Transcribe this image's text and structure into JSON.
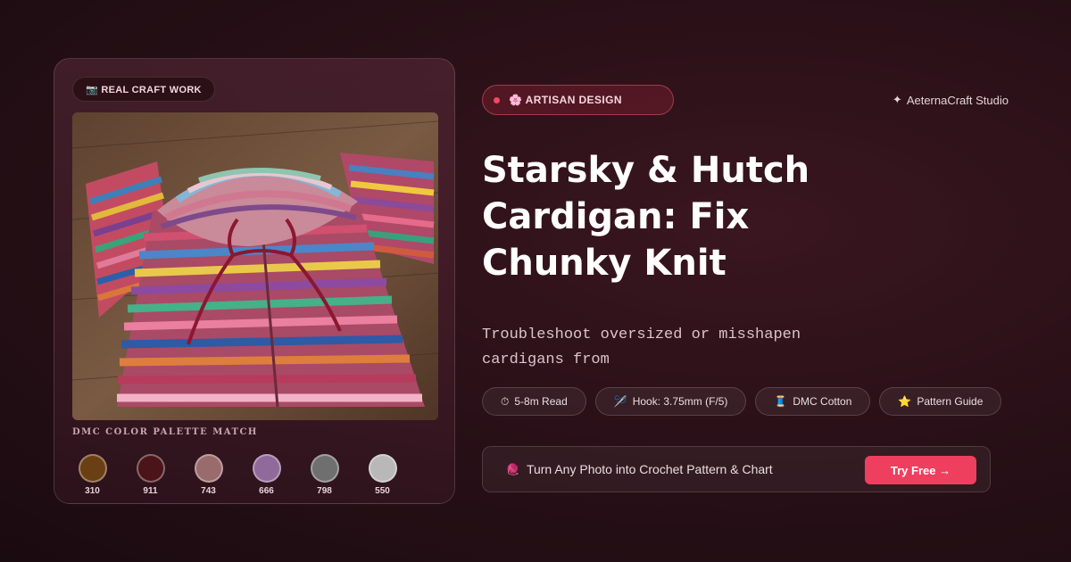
{
  "card": {
    "badge": {
      "icon": "camera-icon",
      "label": "📷 REAL CRAFT WORK"
    },
    "photo": {
      "subject": "cardigan-photo"
    },
    "palette": {
      "title": "DMC COLOR PALETTE MATCH",
      "swatches": [
        {
          "code": "310",
          "color": "#6b3f14"
        },
        {
          "code": "911",
          "color": "#4a1418"
        },
        {
          "code": "743",
          "color": "#9a6b6c"
        },
        {
          "code": "666",
          "color": "#8f6a9a"
        },
        {
          "code": "798",
          "color": "#6f6f6f"
        },
        {
          "code": "550",
          "color": "#b8b8b8"
        }
      ]
    }
  },
  "header": {
    "badge": "🌸 ARTISAN DESIGN",
    "studio_icon": "sparkle-icon",
    "studio": "AeternaCraft Studio"
  },
  "main": {
    "title": "Starsky & Hutch Cardigan: Fix Chunky Knit",
    "subtitle": "Troubleshoot oversized or misshapen cardigans from",
    "chips": [
      {
        "icon": "⏱",
        "label": "5-8m Read"
      },
      {
        "icon": "🪡",
        "label": "Hook: 3.75mm (F/5)"
      },
      {
        "icon": "🧵",
        "label": "DMC Cotton"
      },
      {
        "icon": "⭐",
        "label": "Pattern Guide"
      }
    ]
  },
  "cta": {
    "icon": "🧶",
    "text": "Turn Any Photo into Crochet Pattern & Chart",
    "button": "Try Free →"
  },
  "colors": {
    "accent": "#ef3f5e",
    "background": "#2a1018"
  }
}
